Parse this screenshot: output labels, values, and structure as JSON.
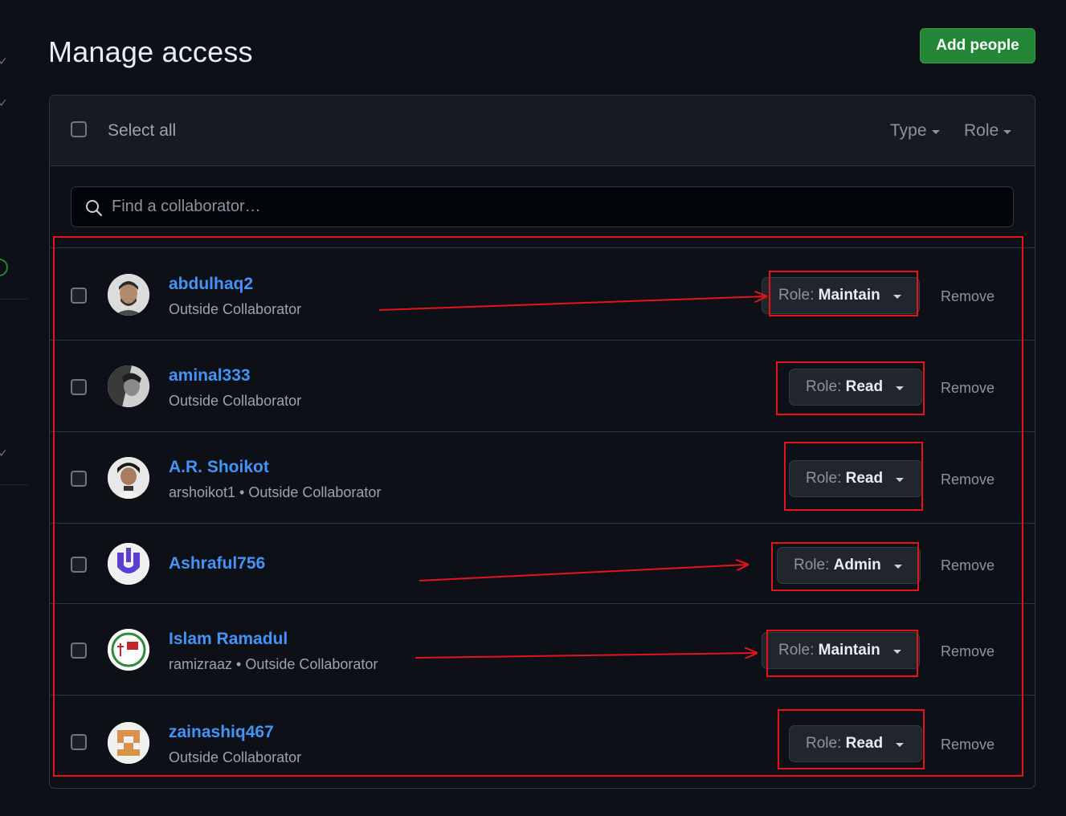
{
  "header": {
    "title": "Manage access",
    "add_people_label": "Add people"
  },
  "toolbar": {
    "select_all_label": "Select all",
    "type_filter_label": "Type",
    "role_filter_label": "Role"
  },
  "search": {
    "placeholder": "Find a collaborator…"
  },
  "collaborators": [
    {
      "name": "abdulhaq2",
      "subtitle": "Outside Collaborator",
      "role_prefix": "Role:",
      "role": "Maintain",
      "remove_label": "Remove"
    },
    {
      "name": "aminal333",
      "subtitle": "Outside Collaborator",
      "role_prefix": "Role:",
      "role": "Read",
      "remove_label": "Remove"
    },
    {
      "name": "A.R. Shoikot",
      "subtitle": "arshoikot1 • Outside Collaborator",
      "role_prefix": "Role:",
      "role": "Read",
      "remove_label": "Remove"
    },
    {
      "name": "Ashraful756",
      "subtitle": "",
      "role_prefix": "Role:",
      "role": "Admin",
      "remove_label": "Remove"
    },
    {
      "name": "Islam Ramadul",
      "subtitle": "ramizraaz • Outside Collaborator",
      "role_prefix": "Role:",
      "role": "Maintain",
      "remove_label": "Remove"
    },
    {
      "name": "zainashiq467",
      "subtitle": "Outside Collaborator",
      "role_prefix": "Role:",
      "role": "Read",
      "remove_label": "Remove"
    }
  ],
  "colors": {
    "accent_link": "#4493f8",
    "primary_button": "#238636",
    "annotation": "#e5131a"
  }
}
